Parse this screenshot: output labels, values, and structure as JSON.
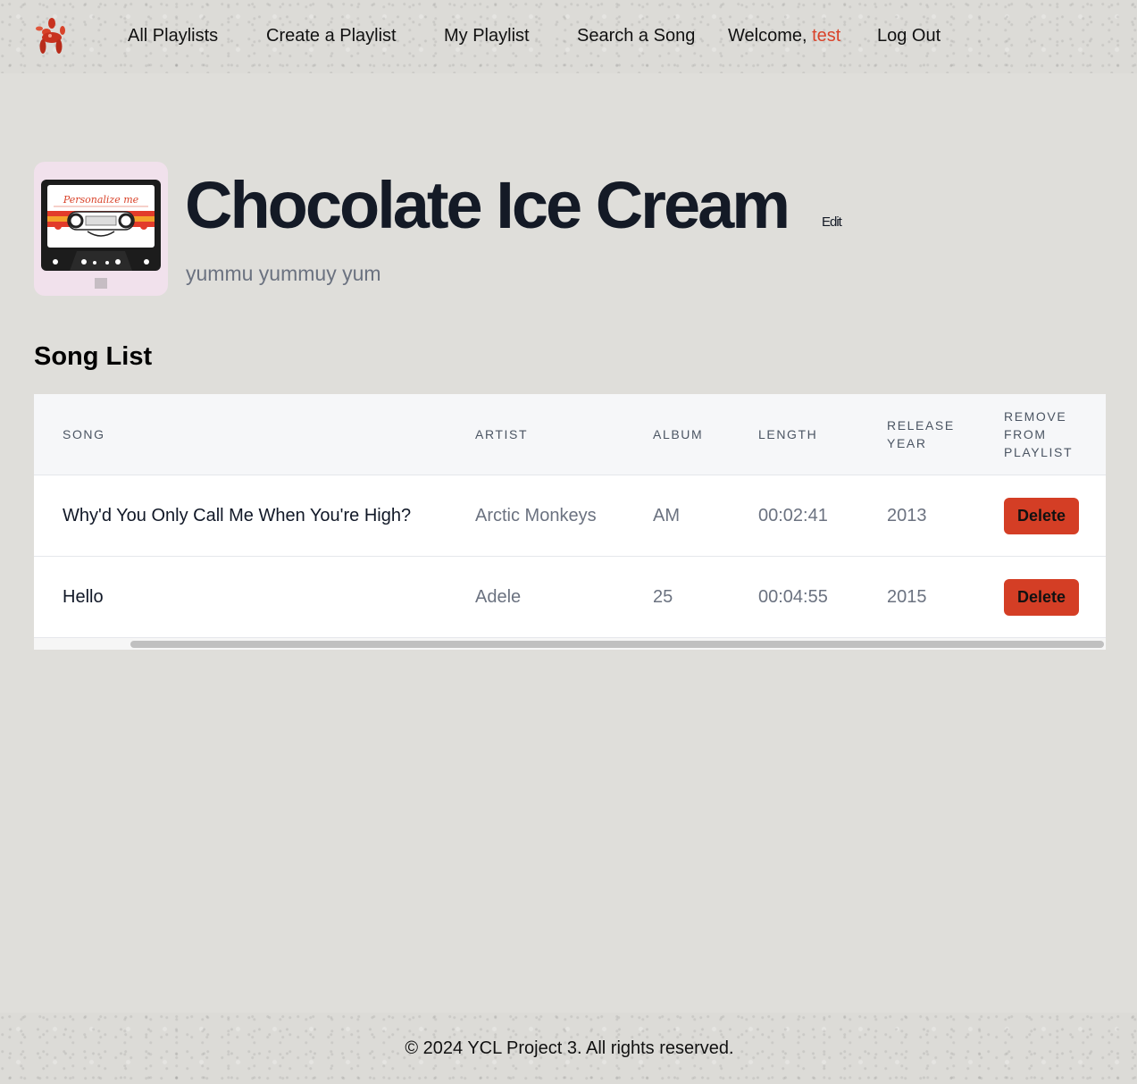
{
  "nav": {
    "items": [
      {
        "label": "All Playlists"
      },
      {
        "label": "Create a Playlist"
      },
      {
        "label": "My Playlist"
      },
      {
        "label": "Search a Song"
      }
    ],
    "welcome_prefix": "Welcome,",
    "username": "test",
    "logout_label": "Log Out"
  },
  "playlist": {
    "title": "Chocolate Ice Cream",
    "edit_label": "Edit",
    "description": "yummu yummuy yum",
    "cover_text": "Personalize me"
  },
  "songs_section": {
    "title": "Song List",
    "headers": [
      "Song",
      "Artist",
      "Album",
      "Length",
      "Release Year",
      "Remove From Playlist"
    ],
    "rows": [
      {
        "song": "Why'd You Only Call Me When You're High?",
        "artist": "Arctic Monkeys",
        "album": "AM",
        "length": "00:02:41",
        "year": "2013",
        "action": "Delete"
      },
      {
        "song": "Hello",
        "artist": "Adele",
        "album": "25",
        "length": "00:04:55",
        "year": "2015",
        "action": "Delete"
      }
    ]
  },
  "footer": {
    "text": "© 2024 YCL Project 3. All rights reserved."
  },
  "colors": {
    "accent": "#d43e25",
    "username": "#d9432a",
    "background": "#dfdeda",
    "title": "#141a26"
  }
}
